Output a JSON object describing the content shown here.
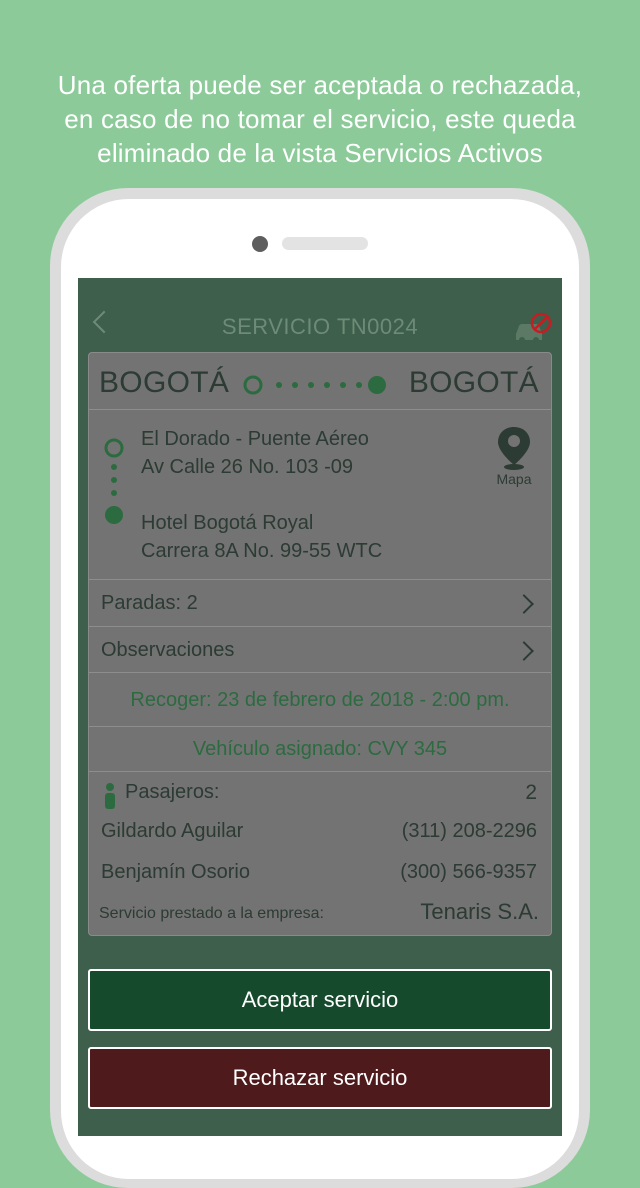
{
  "promo": {
    "lines": [
      "Una oferta puede ser aceptada o rechazada,",
      "en caso de no tomar el servicio, este queda",
      "eliminado de la vista Servicios Activos"
    ]
  },
  "appbar": {
    "title": "SERVICIO TN0024",
    "back_icon": "chevron-left-icon",
    "action_icon": "car-blocked-icon"
  },
  "route": {
    "from_city": "BOGOTÁ",
    "to_city": "BOGOTÁ",
    "origin": {
      "name": "El Dorado - Puente Aéreo",
      "address": "Av Calle 26 No. 103 -09"
    },
    "destination": {
      "name": "Hotel Bogotá Royal",
      "address": "Carrera 8A No. 99-55 WTC"
    },
    "map_label": "Mapa"
  },
  "details": {
    "stops_label": "Paradas: 2",
    "observations_label": "Observaciones",
    "pickup": "Recoger: 23 de febrero de 2018 - 2:00 pm.",
    "vehicle": "Vehículo asignado: CVY 345"
  },
  "passengers": {
    "label": "Pasajeros:",
    "count": "2",
    "list": [
      {
        "name": "Gildardo Aguilar",
        "phone": "(311) 208-2296"
      },
      {
        "name": "Benjamín Osorio",
        "phone": "(300) 566-9357"
      }
    ]
  },
  "company": {
    "label": "Servicio prestado a la empresa:",
    "name": "Tenaris S.A."
  },
  "actions": {
    "accept": "Aceptar servicio",
    "reject": "Rechazar servicio"
  },
  "colors": {
    "background": "#8ccb99",
    "accent_green": "#2c6b40",
    "accept_button": "#154a2c",
    "reject_button": "#4f1a1c",
    "alert_red": "#c41e23"
  }
}
